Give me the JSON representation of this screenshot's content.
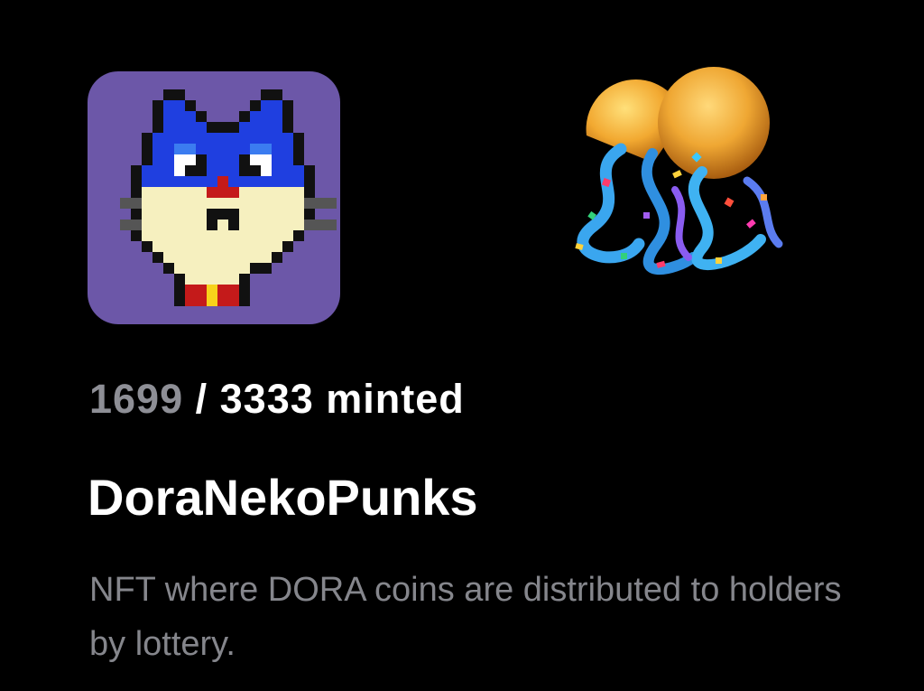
{
  "collection": {
    "minted": "1699",
    "separator": "/",
    "total": "3333",
    "minted_suffix": "minted",
    "name": "DoraNekoPunks",
    "description": "NFT where DORA coins are distributed to holders by lottery."
  },
  "icons": {
    "avatar": "pixel-cat-nft-avatar",
    "party": "party-popper-icon"
  },
  "colors": {
    "background": "#000000",
    "avatar_background": "#6c57a8",
    "muted_text": "#8e8f96",
    "primary_text": "#ffffff"
  }
}
